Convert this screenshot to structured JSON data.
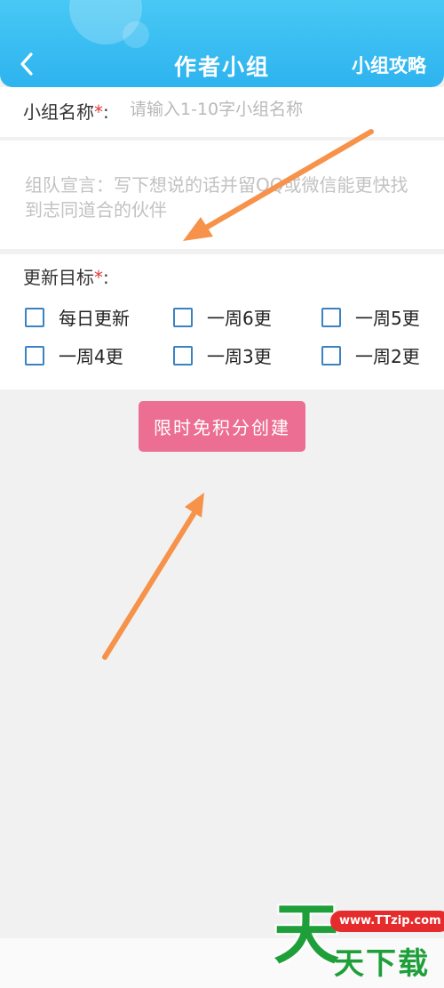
{
  "header": {
    "title": "作者小组",
    "guide_link": "小组攻略",
    "back_icon": "chevron-left-icon"
  },
  "form": {
    "name_label": "小组名称",
    "name_suffix": ":",
    "name_placeholder": "请输入1-10字小组名称",
    "name_value": "",
    "required_mark": "*",
    "declaration_placeholder": "组队宣言：写下想说的话并留QQ或微信能更快找到志同道合的伙伴",
    "declaration_value": "",
    "goal_label": "更新目标",
    "goal_suffix": ":",
    "goal_options": [
      "每日更新",
      "一周6更",
      "一周5更",
      "一周4更",
      "一周3更",
      "一周2更"
    ],
    "create_button": "限时免积分创建"
  },
  "watermark": {
    "url": "www.TTzip.com",
    "char": "天",
    "name": "天下载"
  },
  "colors": {
    "header": "#2db3ef",
    "create_button": "#ec6f93",
    "checkbox_border": "#3b82c4",
    "required": "#e03a3a",
    "annotation_arrow": "#f6924a",
    "watermark_green": "#1f9f3a"
  }
}
